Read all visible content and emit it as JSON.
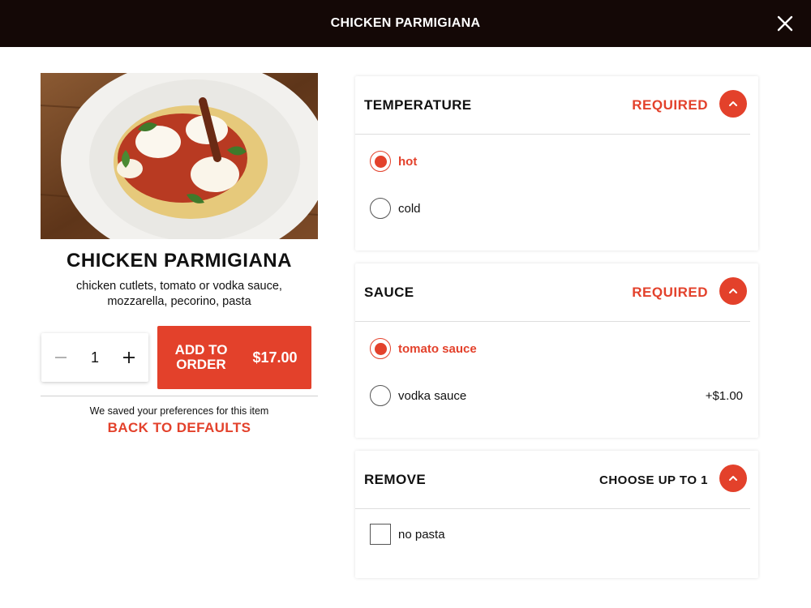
{
  "header": {
    "title": "CHICKEN PARMIGIANA"
  },
  "item": {
    "title": "CHICKEN PARMIGIANA",
    "description": "chicken cutlets, tomato or vodka sauce, mozzarella, pecorino, pasta",
    "quantity": "1",
    "add_label_line1": "ADD TO",
    "add_label_line2": "ORDER",
    "price": "$17.00",
    "saved_note": "We saved your preferences for this item",
    "back_defaults": "BACK TO DEFAULTS"
  },
  "groups": {
    "temperature": {
      "title": "TEMPERATURE",
      "status": "REQUIRED",
      "options": [
        {
          "label": "hot",
          "selected": true
        },
        {
          "label": "cold",
          "selected": false
        }
      ]
    },
    "sauce": {
      "title": "SAUCE",
      "status": "REQUIRED",
      "options": [
        {
          "label": "tomato sauce",
          "selected": true
        },
        {
          "label": "vodka sauce",
          "selected": false,
          "price": "+$1.00"
        }
      ]
    },
    "remove": {
      "title": "REMOVE",
      "status": "CHOOSE UP TO 1",
      "options": [
        {
          "label": "no pasta",
          "checked": false
        }
      ]
    }
  },
  "colors": {
    "accent": "#e3412b",
    "topbar": "#140806"
  },
  "icons": {
    "close": "close-icon",
    "collapse": "chevron-up-icon",
    "minus": "minus-icon",
    "plus": "plus-icon"
  }
}
